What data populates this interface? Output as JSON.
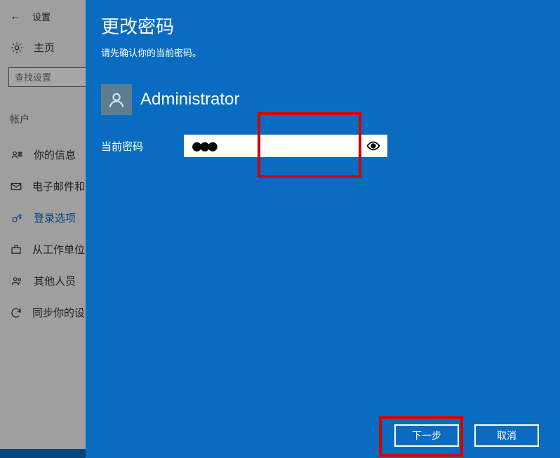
{
  "sidebar": {
    "titlebar": {
      "back_icon": "←",
      "title": "设置"
    },
    "home": {
      "label": "主页"
    },
    "search": {
      "placeholder": "查找设置"
    },
    "section_heading": "帐户",
    "items": [
      {
        "icon": "person-card",
        "label": "你的信息"
      },
      {
        "icon": "mail",
        "label": "电子邮件和..."
      },
      {
        "icon": "key",
        "label": "登录选项",
        "active": true
      },
      {
        "icon": "briefcase",
        "label": "从工作单位..."
      },
      {
        "icon": "people",
        "label": "其他人员"
      },
      {
        "icon": "sync",
        "label": "同步你的设..."
      }
    ]
  },
  "main": {
    "title": "更改密码",
    "subtitle": "请先确认你的当前密码。",
    "username": "Administrator",
    "current_password": {
      "label": "当前密码",
      "masked_value": "●●●"
    },
    "buttons": {
      "next": "下一步",
      "cancel": "取消"
    }
  },
  "highlights": {
    "password_box": true,
    "next_button": true
  }
}
